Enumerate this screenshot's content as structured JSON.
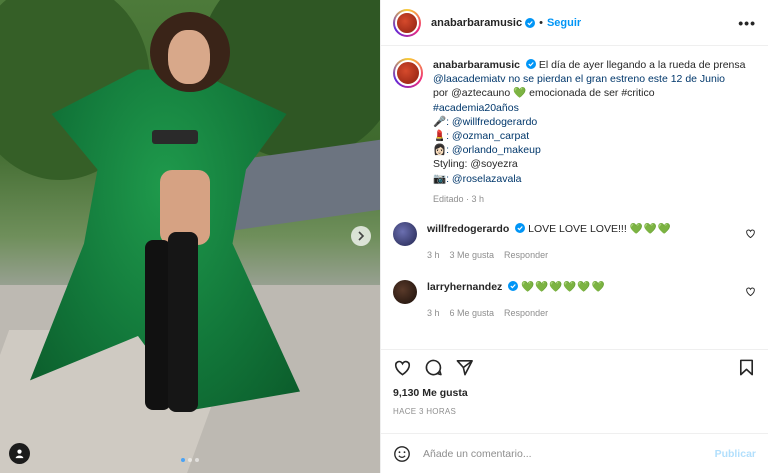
{
  "post": {
    "username": "anabarbaramusic",
    "follow_label": "Seguir",
    "more_label": "•••",
    "caption_lines": [
      "El día de ayer llegando a la rueda de prensa",
      "@laacademiatv no se pierdan el gran estreno este 12 de Junio",
      "por @aztecauno 💚 emocionada de ser #critico",
      "#academia20años",
      "🎤: @willfredogerardo",
      "💄: @ozman_carpat",
      "👩🏻: @orlando_makeup",
      "Styling: @soyezra",
      "📷: @roselazavala"
    ],
    "edited": "Editado · 3 h",
    "likes": "9,130 Me gusta",
    "time_ago": "HACE 3 HORAS"
  },
  "comments": [
    {
      "username": "willfredogerardo",
      "text": "LOVE LOVE LOVE!!! ",
      "emojis": "💚💚💚",
      "time": "3 h",
      "likes": "3 Me gusta",
      "reply": "Responder"
    },
    {
      "username": "larryhernandez",
      "text": "",
      "emojis": "💚💚💚💚💚💚",
      "time": "3 h",
      "likes": "6 Me gusta",
      "reply": "Responder"
    }
  ],
  "composer": {
    "placeholder": "Añade un comentario...",
    "publish_label": "Publicar"
  },
  "colors": {
    "accent": "#0095f6",
    "link": "#00376b",
    "muted": "#8e8e8e",
    "publish_disabled": "#b2dffc"
  },
  "icons": [
    "verified-icon",
    "more-icon",
    "heart-icon",
    "comment-icon",
    "share-icon",
    "bookmark-icon",
    "emoji-icon",
    "next-arrow-icon",
    "tagged-user-icon"
  ]
}
